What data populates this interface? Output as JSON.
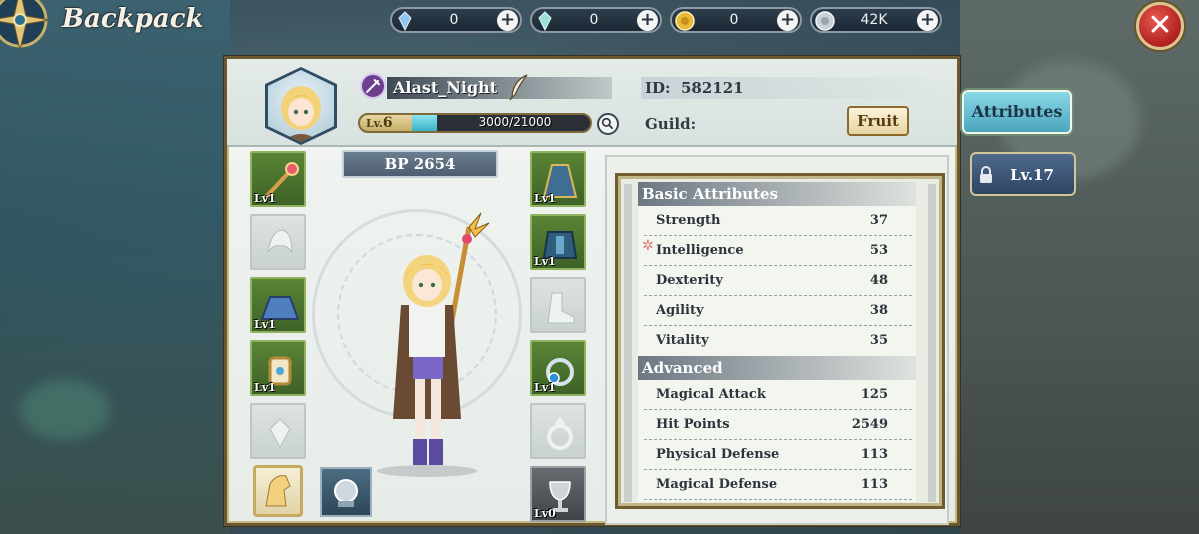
{
  "header": {
    "title": "Backpack",
    "currencies": [
      {
        "icon": "blue-crystal-icon",
        "value": "0"
      },
      {
        "icon": "green-crystal-icon",
        "value": "0"
      },
      {
        "icon": "gold-coin-icon",
        "value": "0"
      },
      {
        "icon": "silver-coin-icon",
        "value": "42K"
      }
    ]
  },
  "profile": {
    "name": "Alast_Night",
    "level_label": "Lv.",
    "level": "6",
    "exp": "3000/21000",
    "exp_fraction": 0.1429,
    "id_label": "ID:",
    "id_value": "582121",
    "guild_label": "Guild:",
    "fruit_button": "Fruit"
  },
  "equipment": {
    "bp": "BP 2654",
    "left_slots": [
      {
        "icon": "staff-icon",
        "lv": "Lv1",
        "state": "filled"
      },
      {
        "icon": "hat-icon",
        "lv": "",
        "state": "empty"
      },
      {
        "icon": "skirt-icon",
        "lv": "Lv1",
        "state": "filled"
      },
      {
        "icon": "bracelet-icon",
        "lv": "Lv1",
        "state": "filled"
      },
      {
        "icon": "emblem-icon",
        "lv": "",
        "state": "empty"
      }
    ],
    "right_slots": [
      {
        "icon": "cape-icon",
        "lv": "Lv1",
        "state": "filled"
      },
      {
        "icon": "armor-icon",
        "lv": "Lv1",
        "state": "filled"
      },
      {
        "icon": "boots-icon",
        "lv": "",
        "state": "empty"
      },
      {
        "icon": "ring-icon",
        "lv": "Lv1",
        "state": "filled"
      },
      {
        "icon": "ring-empty-icon",
        "lv": "",
        "state": "empty"
      },
      {
        "icon": "chalice-icon",
        "lv": "Lv0",
        "state": "dark"
      }
    ]
  },
  "attributes": {
    "basic_title": "Basic Attributes",
    "basic": [
      {
        "name": "Strength",
        "value": "37"
      },
      {
        "name": "Intelligence",
        "value": "53"
      },
      {
        "name": "Dexterity",
        "value": "48"
      },
      {
        "name": "Agility",
        "value": "38"
      },
      {
        "name": "Vitality",
        "value": "35"
      }
    ],
    "advanced_title": "Advanced",
    "advanced": [
      {
        "name": "Magical Attack",
        "value": "125"
      },
      {
        "name": "Hit Points",
        "value": "2549"
      },
      {
        "name": "Physical Defense",
        "value": "113"
      },
      {
        "name": "Magical Defense",
        "value": "113"
      }
    ]
  },
  "tabs": {
    "attributes": "Attributes",
    "locked_level": "Lv.17"
  }
}
